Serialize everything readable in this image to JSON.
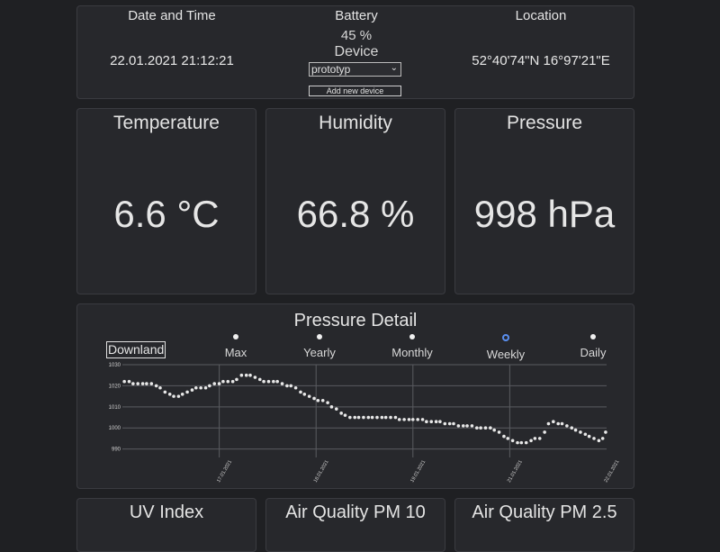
{
  "info": {
    "date_heading": "Date and Time",
    "date_value": "22.01.2021 21:12:21",
    "battery_heading": "Battery",
    "battery_value": "45 %",
    "device_label": "Device",
    "device_selected": "prototyp",
    "add_device_label": "Add new device",
    "location_heading": "Location",
    "location_value": "52°40'74\"N 16°97'21\"E"
  },
  "metrics": {
    "temperature": {
      "title": "Temperature",
      "value": "6.6 °C"
    },
    "humidity": {
      "title": "Humidity",
      "value": "66.8 %"
    },
    "pressure": {
      "title": "Pressure",
      "value": "998 hPa"
    }
  },
  "detail": {
    "title": "Pressure Detail",
    "download_label": "Downland",
    "ranges": [
      {
        "label": "Max",
        "active": false
      },
      {
        "label": "Yearly",
        "active": false
      },
      {
        "label": "Monthly",
        "active": false
      },
      {
        "label": "Weekly",
        "active": true
      },
      {
        "label": "Daily",
        "active": false
      }
    ]
  },
  "bottom": {
    "uv_title": "UV Index",
    "pm10_title": "Air Quality PM 10",
    "pm25_title": "Air Quality PM 2.5"
  },
  "colors": {
    "background": "#1f2023",
    "card": "#27282c",
    "active_radio": "#5a8ff0",
    "points": "#e8e8e8",
    "grid": "#5a5b60"
  },
  "chart_data": {
    "type": "scatter",
    "title": "",
    "xlabel": "",
    "ylabel": "",
    "ylim": [
      986,
      1030
    ],
    "y_ticks": [
      990,
      1000,
      1010,
      1020,
      1030
    ],
    "x_ticks": [
      "17.01.2021",
      "18.01.2021",
      "19.01.2021",
      "21.01.2021",
      "22.01.2021"
    ],
    "x_tick_positions_days": [
      1.0,
      2.0,
      3.0,
      4.0,
      5.0
    ],
    "x_range_days": [
      0,
      5.0
    ],
    "grid": true,
    "series": [
      {
        "name": "",
        "x": [
          0.02,
          0.07,
          0.11,
          0.16,
          0.21,
          0.25,
          0.3,
          0.35,
          0.39,
          0.44,
          0.49,
          0.53,
          0.58,
          0.62,
          0.67,
          0.72,
          0.76,
          0.81,
          0.86,
          0.9,
          0.95,
          1.0,
          1.04,
          1.09,
          1.14,
          1.18,
          1.23,
          1.28,
          1.32,
          1.37,
          1.42,
          1.46,
          1.51,
          1.56,
          1.6,
          1.65,
          1.7,
          1.74,
          1.79,
          1.84,
          1.88,
          1.93,
          1.98,
          2.02,
          2.07,
          2.12,
          2.16,
          2.21,
          2.26,
          2.3,
          2.35,
          2.4,
          2.44,
          2.49,
          2.54,
          2.58,
          2.63,
          2.68,
          2.72,
          2.77,
          2.82,
          2.86,
          2.91,
          2.96,
          3.0,
          3.05,
          3.1,
          3.14,
          3.19,
          3.24,
          3.28,
          3.33,
          3.38,
          3.42,
          3.47,
          3.52,
          3.56,
          3.61,
          3.66,
          3.7,
          3.75,
          3.8,
          3.84,
          3.89,
          3.94,
          3.98,
          4.03,
          4.08,
          4.12,
          4.17,
          4.22,
          4.26,
          4.31,
          4.36,
          4.4,
          4.45,
          4.5,
          4.54,
          4.59,
          4.64,
          4.68,
          4.73,
          4.78,
          4.82,
          4.87,
          4.92,
          4.96,
          4.99
        ],
        "y": [
          1022,
          1022,
          1021,
          1021,
          1021,
          1021,
          1021,
          1020,
          1019,
          1017,
          1016,
          1015,
          1015,
          1016,
          1017,
          1018,
          1019,
          1019,
          1019,
          1020,
          1021,
          1021,
          1022,
          1022,
          1022,
          1023,
          1025,
          1025,
          1025,
          1024,
          1023,
          1022,
          1022,
          1022,
          1022,
          1021,
          1020,
          1020,
          1019,
          1017,
          1016,
          1015,
          1014,
          1013,
          1013,
          1012,
          1010,
          1009,
          1007,
          1006,
          1005,
          1005,
          1005,
          1005,
          1005,
          1005,
          1005,
          1005,
          1005,
          1005,
          1005,
          1004,
          1004,
          1004,
          1004,
          1004,
          1004,
          1003,
          1003,
          1003,
          1003,
          1002,
          1002,
          1002,
          1001,
          1001,
          1001,
          1001,
          1000,
          1000,
          1000,
          1000,
          999,
          998,
          996,
          995,
          994,
          993,
          993,
          993,
          994,
          995,
          995,
          998,
          1002,
          1003,
          1002,
          1002,
          1001,
          1000,
          999,
          998,
          997,
          996,
          995,
          994,
          995,
          998
        ]
      }
    ]
  }
}
